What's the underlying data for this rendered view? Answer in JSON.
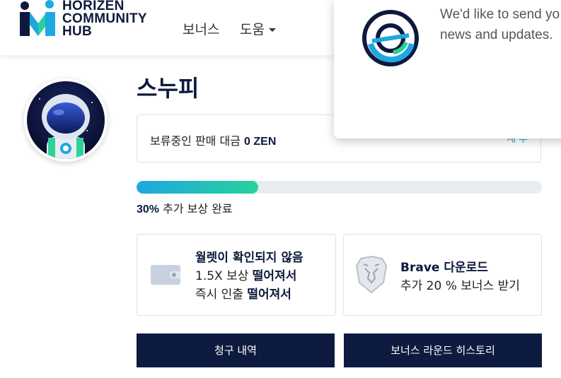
{
  "header": {
    "logo_lines": [
      "HORIZEN",
      "COMMUNITY",
      "HUB"
    ],
    "nav": {
      "bonus": "보너스",
      "help": "도움"
    }
  },
  "profile": {
    "username": "스누피"
  },
  "pending": {
    "label": "보류중인 판매 대금",
    "amount": "0 ZEN",
    "link": "세 부"
  },
  "progress": {
    "percent_text": "30%",
    "label": "추가 보상 완료",
    "fraction": 0.3
  },
  "cards": {
    "wallet": {
      "title": "월렛이 확인되지 않음",
      "line2_prefix": "1.5X 보상",
      "line2_bold": "떨어져서",
      "line3_prefix": "즉시 인출",
      "line3_bold": "떨어져서",
      "icon": "wallet-icon"
    },
    "brave": {
      "title": "Brave 다운로드",
      "subtitle": "추가 20 % 보너스 받기",
      "icon": "brave-lion-icon"
    }
  },
  "buttons": {
    "claims": "청구 내역",
    "rounds": "보너스 라운드 히스토리"
  },
  "popup": {
    "line1": "We'd like to send yo",
    "line2": "news and updates.",
    "icon": "horizen-logo-icon"
  },
  "colors": {
    "navy": "#0c1b3f",
    "progress_start": "#1fa7e2",
    "progress_end": "#26d29a"
  }
}
